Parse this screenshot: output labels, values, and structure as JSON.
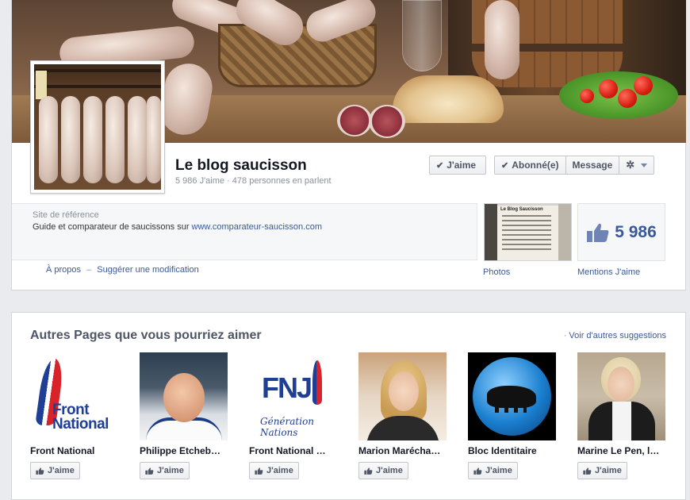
{
  "page": {
    "title": "Le blog saucisson",
    "stats": "5 986 J'aime · 478 personnes en parlent"
  },
  "actions": {
    "like_label": "J'aime",
    "subscribed_label": "Abonné(e)",
    "message_label": "Message",
    "check_icon": "check-icon",
    "gear_icon": "gear-icon"
  },
  "about": {
    "category": "Site de référence",
    "description": "Guide et comparateur de saucissons sur ",
    "link": "www.comparateur-saucisson.com",
    "about_link": "À propos",
    "separator": "–",
    "suggest_link": "Suggérer une modification"
  },
  "photos": {
    "label": "Photos",
    "thumb_title": "Le Blog Saucisson"
  },
  "likes": {
    "count": "5 986",
    "label": "Mentions J'aime"
  },
  "suggestions": {
    "title": "Autres Pages que vous pourriez aimer",
    "more_bullet": "·",
    "more_link": "Voir d'autres suggestions",
    "like_label": "J'aime",
    "items": [
      {
        "name": "Front National",
        "logo_text": "Front\nNational"
      },
      {
        "name": "Philippe Etcheb…"
      },
      {
        "name": "Front National …",
        "logo_text": "FNJ",
        "logo_sub": "Génération Nations"
      },
      {
        "name": "Marion Maréchа…"
      },
      {
        "name": "Bloc Identitaire"
      },
      {
        "name": "Marine Le Pen, l…"
      }
    ]
  },
  "colors": {
    "link": "#3b5998",
    "background": "#e9ebee",
    "fn_blue": "#1f3f95",
    "fn_red": "#d8232a"
  }
}
